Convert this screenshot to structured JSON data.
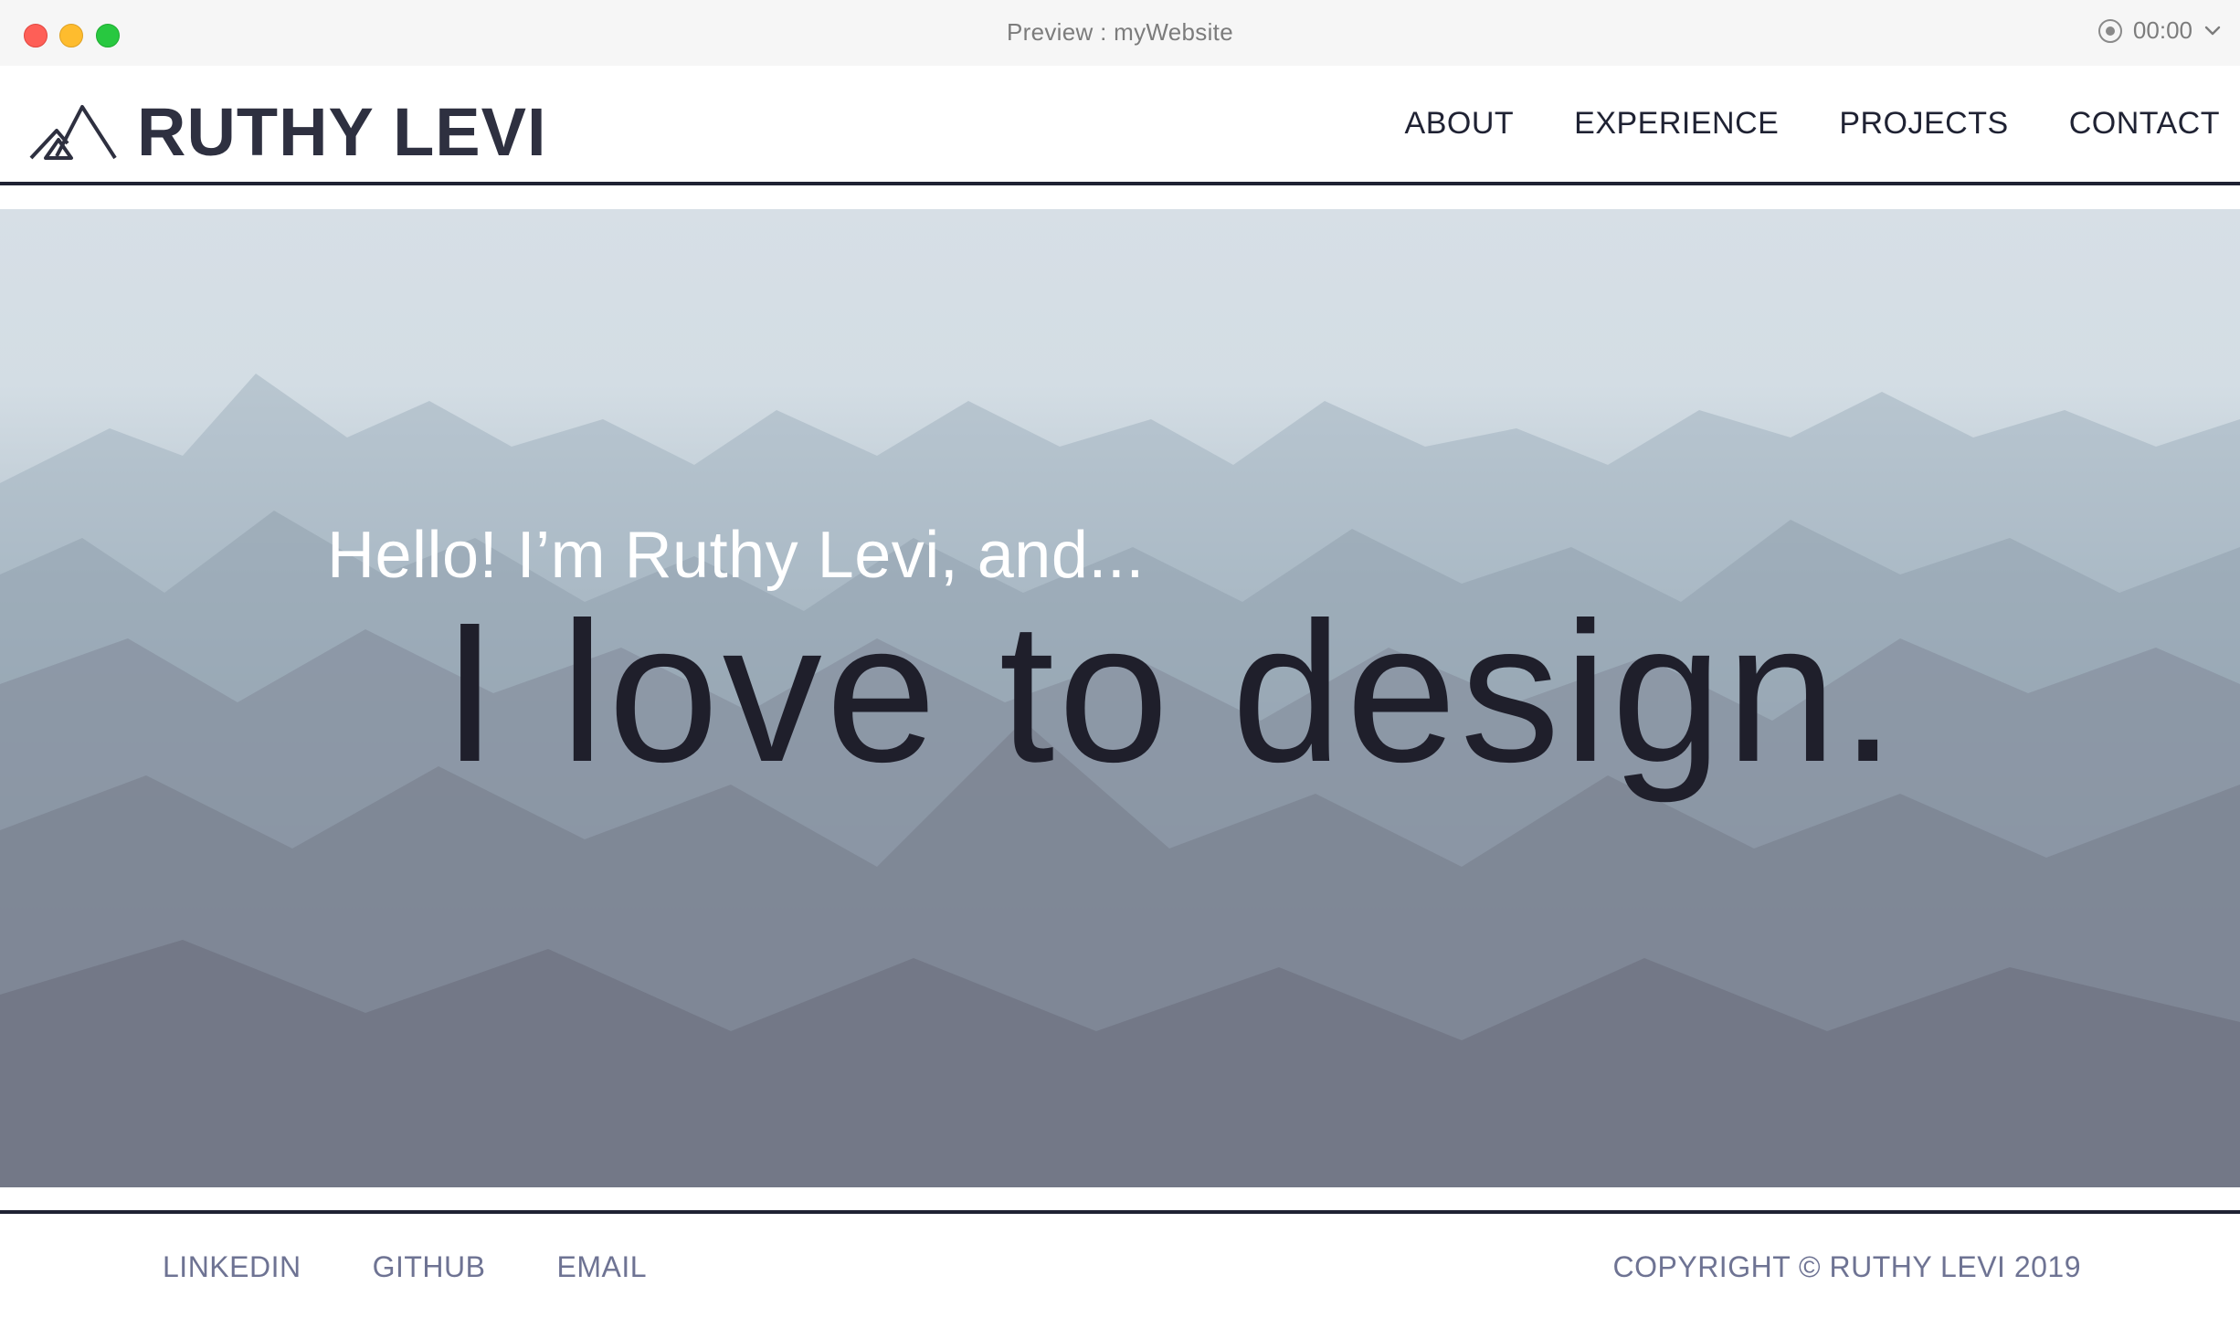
{
  "window": {
    "title": "Preview : myWebsite",
    "timer": "00:00"
  },
  "header": {
    "logo_text": "RUTHY LEVI",
    "nav": [
      "ABOUT",
      "EXPERIENCE",
      "PROJECTS",
      "CONTACT"
    ]
  },
  "hero": {
    "greeting": "Hello! I’m Ruthy Levi, and...",
    "headline": "I love to design."
  },
  "footer": {
    "links": [
      "LINKEDIN",
      "GITHUB",
      "EMAIL"
    ],
    "copyright": "COPYRIGHT © RUTHY LEVI 2019"
  },
  "colors": {
    "header_rule": "#1f2233",
    "headline": "#1f1f2b",
    "footer_text": "#6e7393",
    "titlebar": "#f6f6f6"
  },
  "icons": [
    "mountain-logo-icon",
    "record-icon",
    "chevron-down-icon"
  ]
}
